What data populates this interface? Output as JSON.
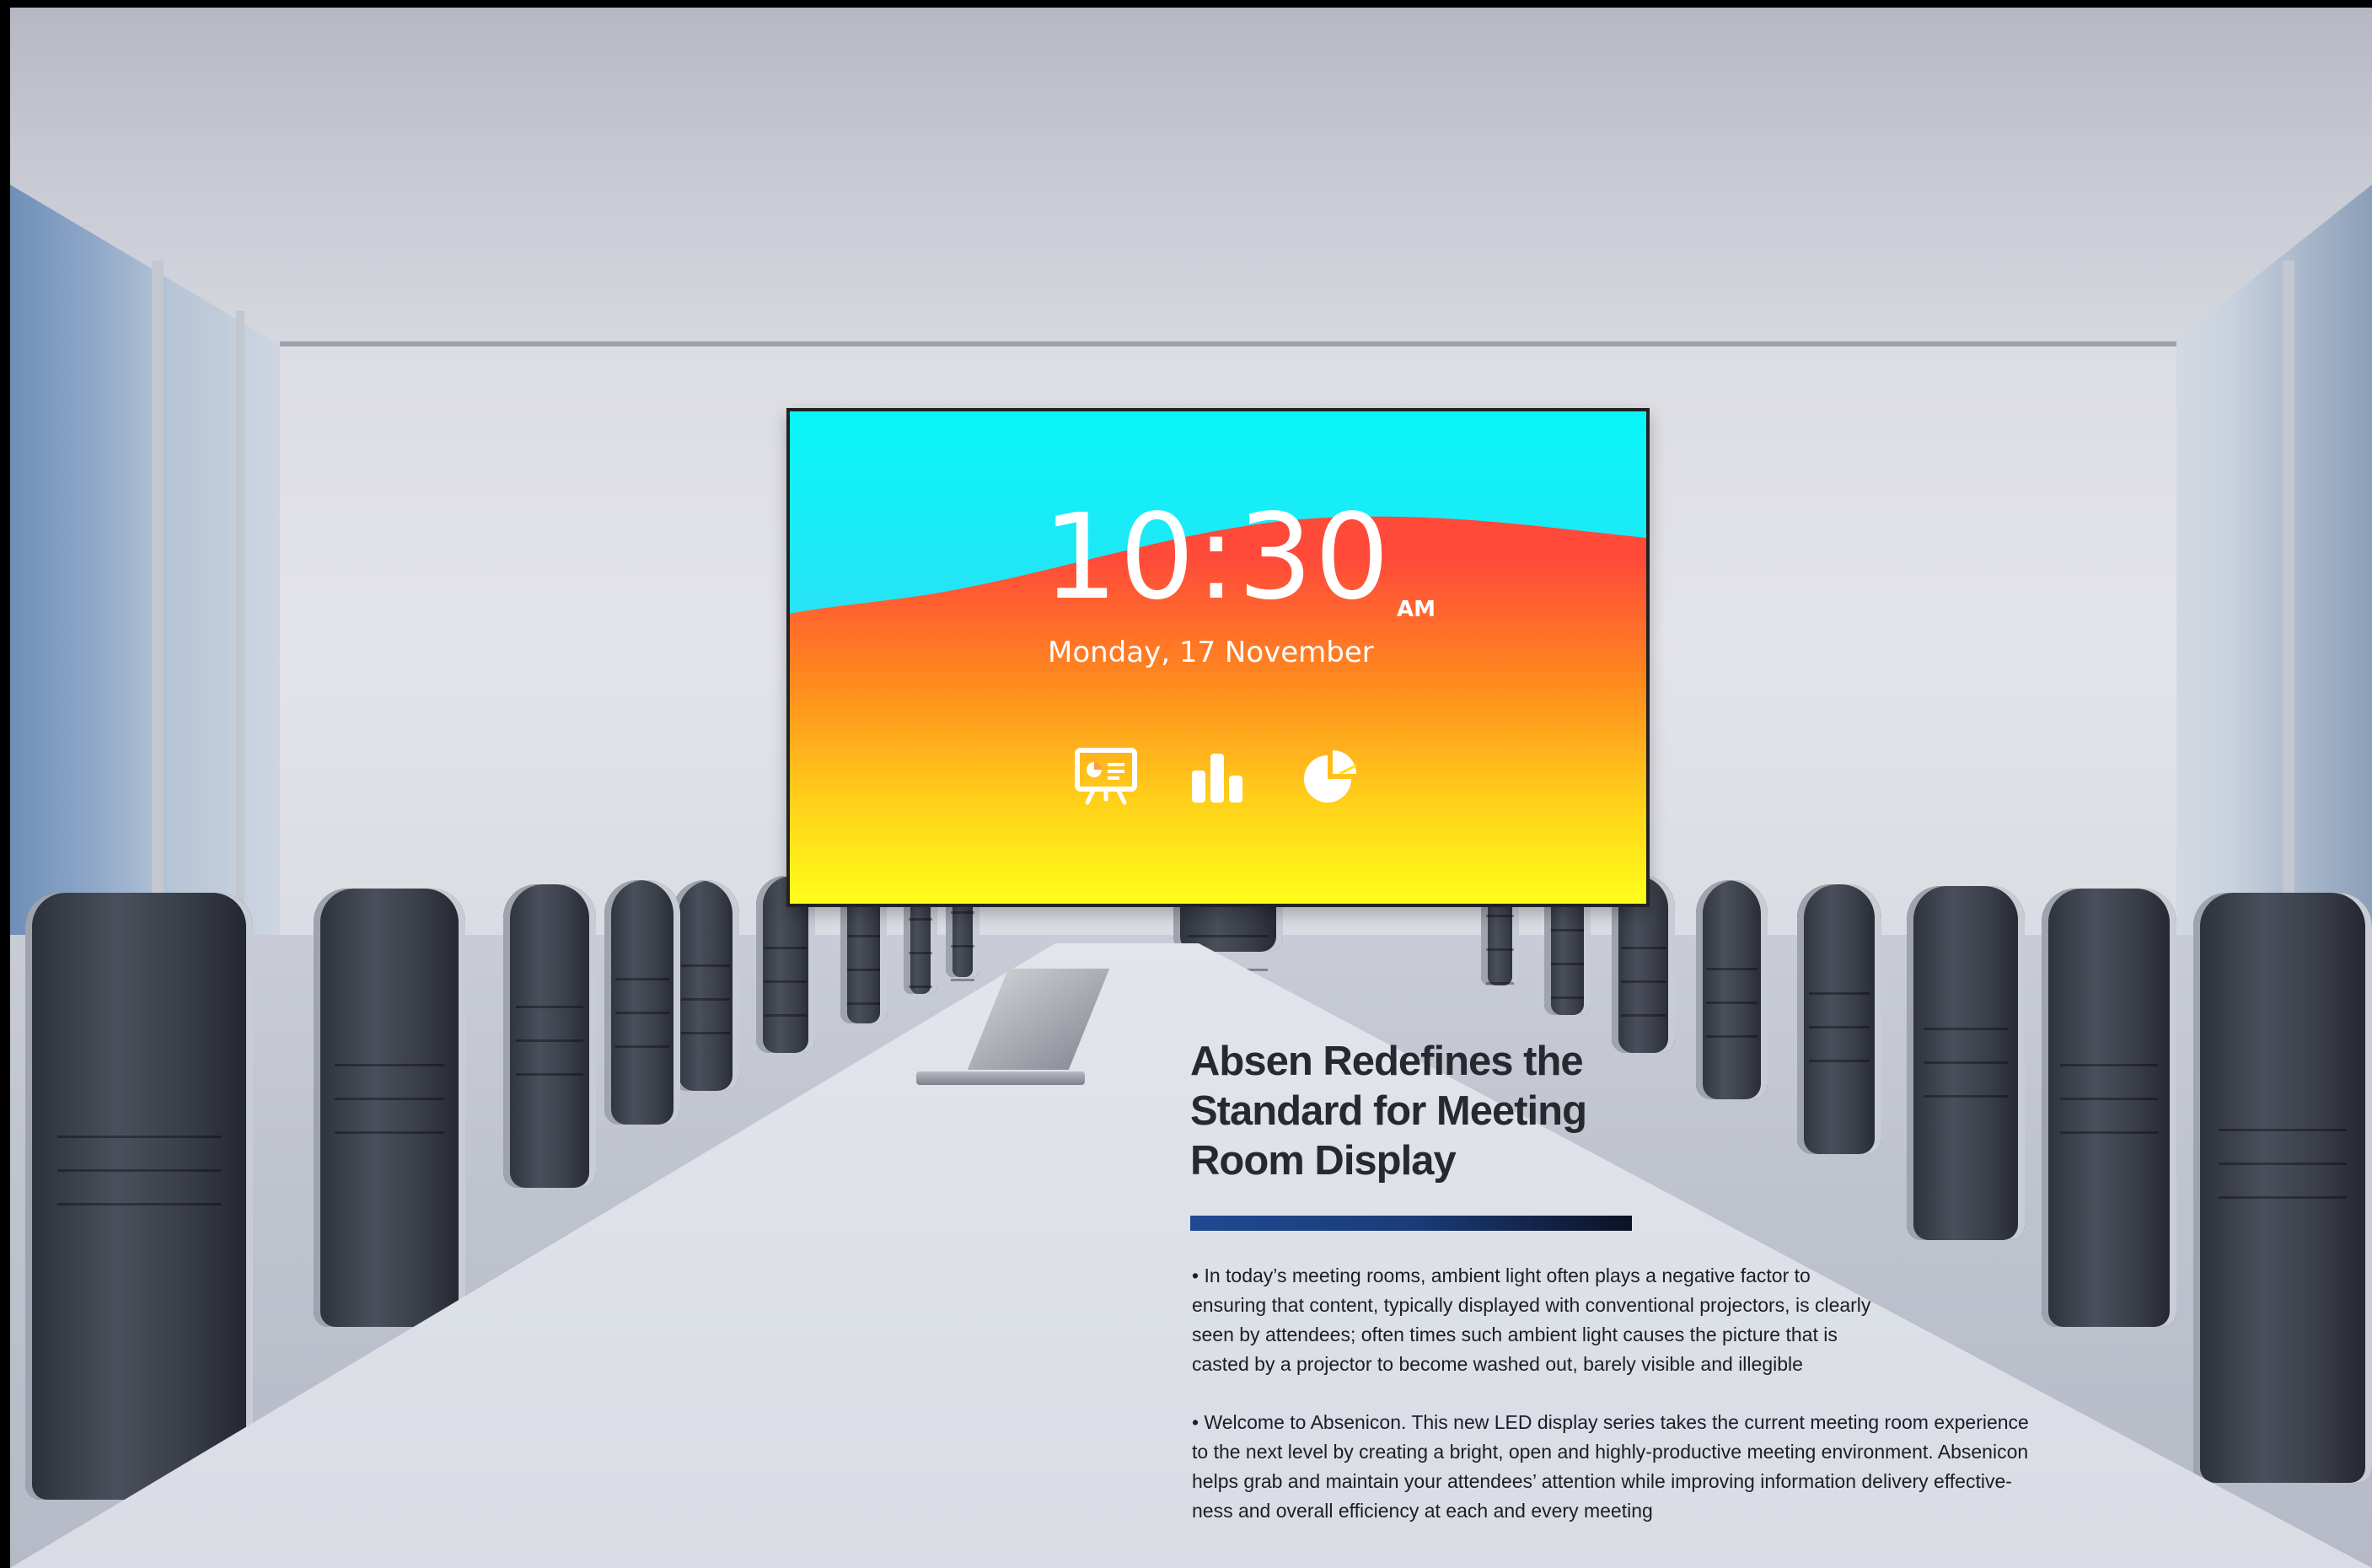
{
  "display": {
    "time": "10:30",
    "ampm": "AM",
    "date": "Monday, 17 November",
    "icons": [
      "presentation-board-icon",
      "bar-chart-icon",
      "pie-chart-icon"
    ]
  },
  "article": {
    "title_line1": "Absen Redefines the",
    "title_line2": "Standard for Meeting",
    "title_line3": "Room Display",
    "accent_colors": [
      "#1e4a92",
      "#0d1226"
    ],
    "paragraphs": [
      {
        "lines": [
          "• In today’s meeting rooms, ambient light often plays a negative factor to",
          "ensuring that content, typically displayed with conventional projectors, is clearly",
          "seen by attendees; often times such ambient light causes the picture that is",
          "casted by a projector to become washed out, barely visible and illegible"
        ]
      },
      {
        "lines": [
          "• Welcome to Absenicon. This new LED display series takes the current meeting room experience",
          "to the next level by creating a bright, open and highly-productive meeting environment. Absenicon",
          "helps grab and maintain your attendees’ attention while improving information delivery effective-",
          "ness and overall efficiency at each and every meeting"
        ]
      }
    ]
  }
}
